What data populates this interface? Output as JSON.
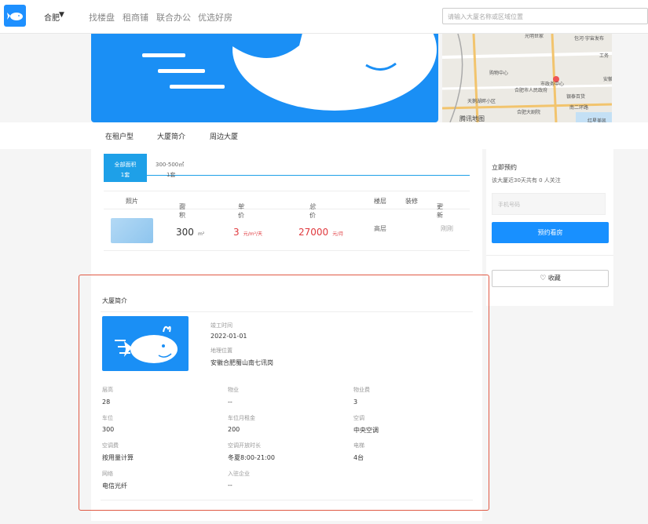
{
  "header": {
    "city": "合肥",
    "nav": [
      "找楼盘",
      "租商铺",
      "联合办公",
      "优选好房"
    ],
    "search_placeholder": "请输入大厦名称或区域位置"
  },
  "map": {
    "labels": [
      "光明世家",
      "包河·宇宙发布",
      "工务",
      "购物中心",
      "市政务中心",
      "安徽",
      "合肥市人民政府",
      "银泰百货",
      "天鹅湖畔小区",
      "南二环路",
      "腾讯地图",
      "合肥大剧院",
      "红星美凯"
    ]
  },
  "tabs": [
    "在租户型",
    "大厦简介",
    "周边大厦"
  ],
  "area_tabs": [
    {
      "label": "全部面积",
      "count": "1套"
    },
    {
      "label": "300-500㎡",
      "count": "1套"
    }
  ],
  "table": {
    "headers": [
      "照片",
      "面积",
      "单价",
      "总价",
      "楼层",
      "装修",
      "更新"
    ],
    "rows": [
      {
        "area": "300",
        "area_unit": "m²",
        "price": "3",
        "price_unit": "元/m²/天",
        "total": "27000",
        "total_unit": "元/月",
        "floor": "高层",
        "decoration": "",
        "updated": "刚刚"
      }
    ]
  },
  "booking": {
    "title": "立即预约",
    "subtitle": "该大厦近30天共有 0 人关注",
    "phone_placeholder": "手机号码",
    "submit_label": "预约看房",
    "favorite_label": "收藏"
  },
  "intro": {
    "title": "大厦简介",
    "built_label": "竣工时间",
    "built_value": "2022-01-01",
    "location_label": "地理位置",
    "location_value": "安徽合肥蜀山南七讯岗",
    "fields": [
      {
        "label": "层高",
        "value": "28"
      },
      {
        "label": "物业",
        "value": "--"
      },
      {
        "label": "物业费",
        "value": "3"
      },
      {
        "label": "车位",
        "value": "300"
      },
      {
        "label": "车位月租金",
        "value": "200"
      },
      {
        "label": "空调",
        "value": "中央空调"
      },
      {
        "label": "空调费",
        "value": "按用量计算"
      },
      {
        "label": "空调开放时长",
        "value": "冬夏8:00-21:00"
      },
      {
        "label": "电梯",
        "value": "4台"
      },
      {
        "label": "网络",
        "value": "电信光纤"
      },
      {
        "label": "入驻企业",
        "value": "--"
      }
    ]
  },
  "colors": {
    "accent": "#1890ff",
    "price_red": "#e0393e",
    "brand_blue": "#1a8ff5"
  }
}
